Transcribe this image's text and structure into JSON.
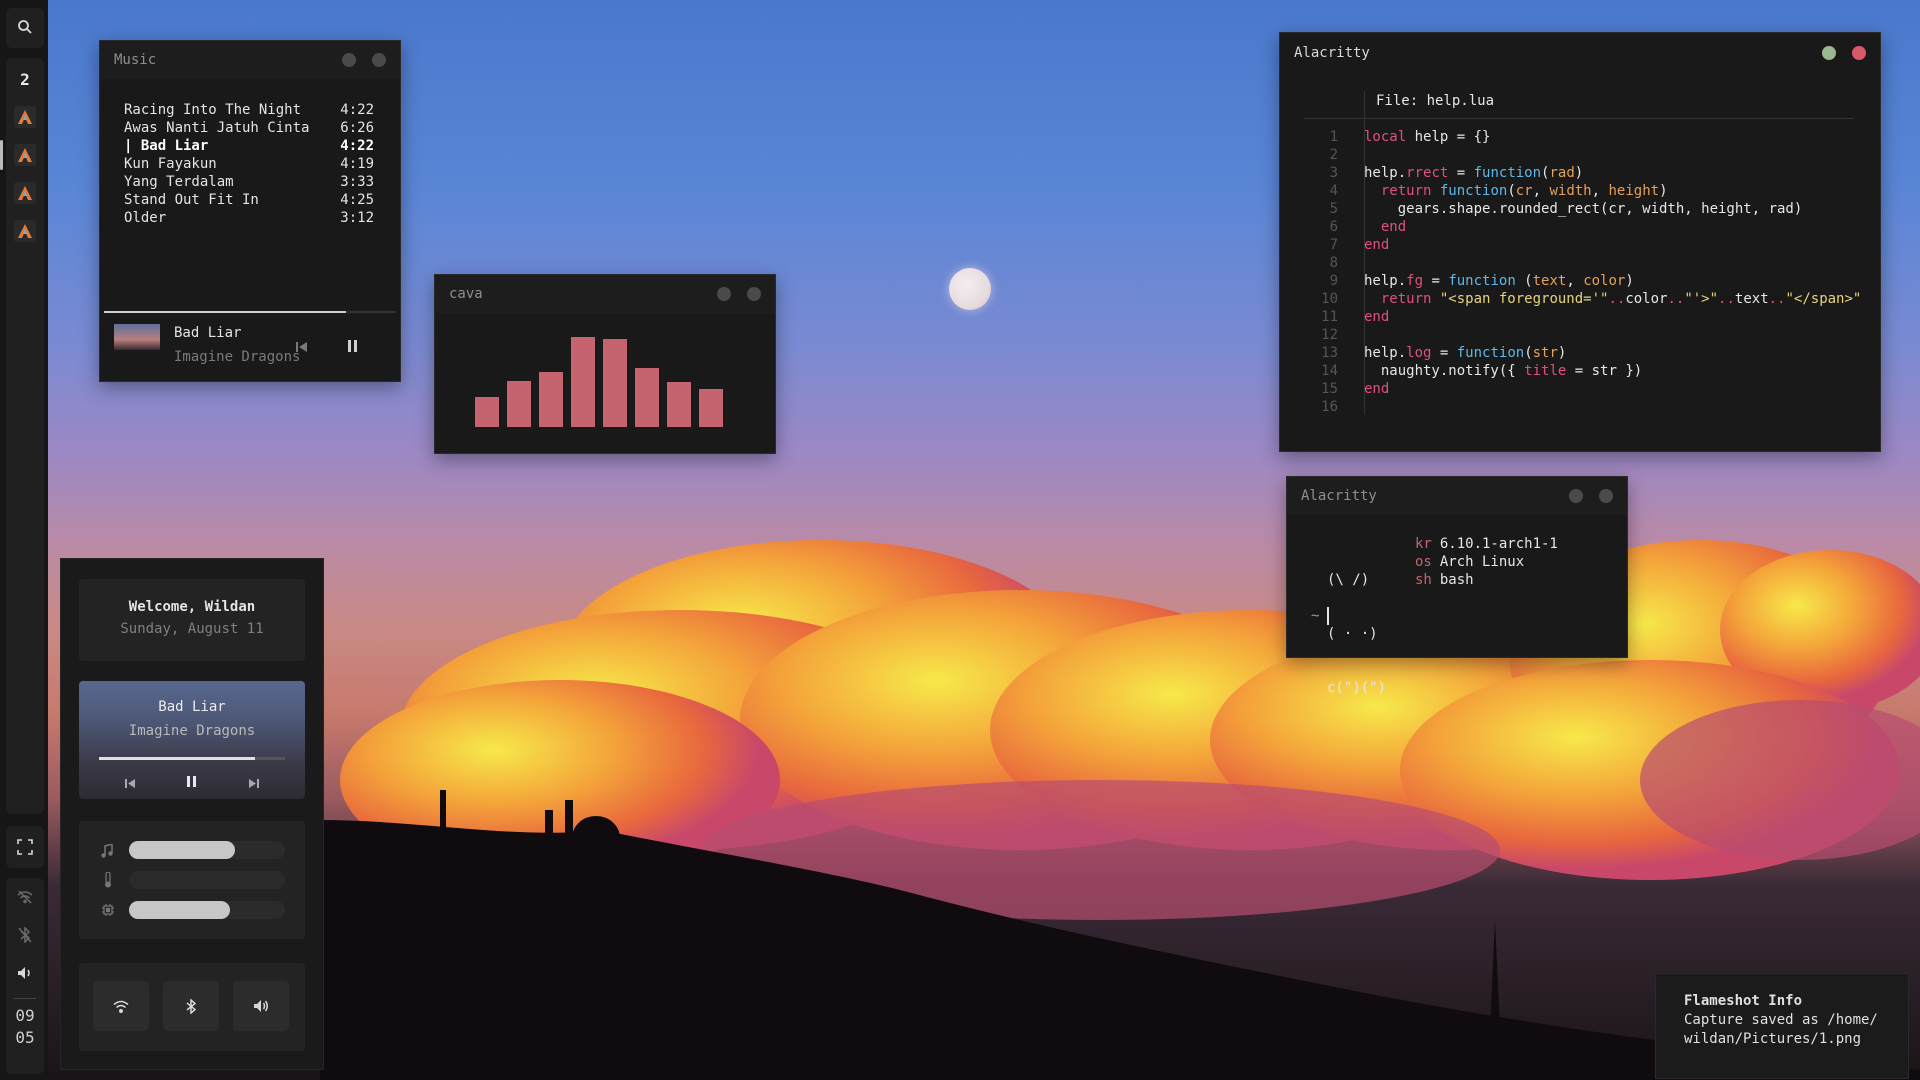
{
  "colors": {
    "bar_bg": "#161616",
    "window_bg": "#191919",
    "cava_bar": "#c5646e",
    "close_red": "#d9596a",
    "max_green": "#9cb68f",
    "keyword": "#e0517a",
    "function": "#5fb8e8",
    "param": "#e6a05a",
    "string": "#e8d37a"
  },
  "sidebar": {
    "search_icon": "search-icon",
    "workspace_number": "2",
    "app_icons": [
      "alacritty-icon",
      "alacritty-icon",
      "alacritty-icon",
      "alacritty-icon"
    ],
    "fullscreen_icon": "fullscreen-icon",
    "status_icons": [
      "wifi-off-icon",
      "bluetooth-off-icon",
      "volume-icon"
    ],
    "clock_hour": "09",
    "clock_minute": "05"
  },
  "music": {
    "title": "Music",
    "playlist": [
      {
        "name": "Racing Into The Night",
        "duration": "4:22"
      },
      {
        "name": "Awas Nanti Jatuh Cinta",
        "duration": "6:26"
      },
      {
        "name": "| Bad Liar",
        "duration": "4:22"
      },
      {
        "name": "Kun Fayakun",
        "duration": "4:19"
      },
      {
        "name": "Yang Terdalam",
        "duration": "3:33"
      },
      {
        "name": "Stand Out Fit In",
        "duration": "4:25"
      },
      {
        "name": "Older",
        "duration": "3:12"
      }
    ],
    "active_index": 2,
    "progress": 0.83,
    "now_playing_title": "Bad Liar",
    "now_playing_artist": "Imagine Dragons"
  },
  "cava": {
    "title": "cava",
    "bars": [
      0.3,
      0.46,
      0.55,
      0.9,
      0.88,
      0.59,
      0.45,
      0.38
    ]
  },
  "editor": {
    "title": "Alacritty",
    "file_label": "File: ",
    "file_name": "help.lua",
    "lines": [
      [
        [
          "k",
          "local"
        ],
        [
          "t",
          " help = {}"
        ]
      ],
      [],
      [
        [
          "t",
          "help."
        ],
        [
          "k",
          "rrect"
        ],
        [
          "t",
          " = "
        ],
        [
          "f",
          "function"
        ],
        [
          "t",
          "("
        ],
        [
          "p",
          "rad"
        ],
        [
          "t",
          ")"
        ]
      ],
      [
        [
          "t",
          "  "
        ],
        [
          "k",
          "return"
        ],
        [
          "t",
          " "
        ],
        [
          "f",
          "function"
        ],
        [
          "t",
          "("
        ],
        [
          "p",
          "cr"
        ],
        [
          "t",
          ", "
        ],
        [
          "p",
          "width"
        ],
        [
          "t",
          ", "
        ],
        [
          "p",
          "height"
        ],
        [
          "t",
          ")"
        ]
      ],
      [
        [
          "t",
          "    gears.shape.rounded_rect(cr, width, height, rad)"
        ]
      ],
      [
        [
          "t",
          "  "
        ],
        [
          "k",
          "end"
        ]
      ],
      [
        [
          "k",
          "end"
        ]
      ],
      [],
      [
        [
          "t",
          "help."
        ],
        [
          "k",
          "fg"
        ],
        [
          "t",
          " = "
        ],
        [
          "f",
          "function"
        ],
        [
          "t",
          " ("
        ],
        [
          "p",
          "text"
        ],
        [
          "t",
          ", "
        ],
        [
          "p",
          "color"
        ],
        [
          "t",
          ")"
        ]
      ],
      [
        [
          "t",
          "  "
        ],
        [
          "k",
          "return"
        ],
        [
          "t",
          " "
        ],
        [
          "s",
          "\"<span foreground='\""
        ],
        [
          "k",
          ".."
        ],
        [
          "t",
          "color"
        ],
        [
          "k",
          ".."
        ],
        [
          "s",
          "\"'>\""
        ],
        [
          "k",
          ".."
        ],
        [
          "t",
          "text"
        ],
        [
          "k",
          ".."
        ],
        [
          "s",
          "\"</span>\""
        ]
      ],
      [
        [
          "k",
          "end"
        ]
      ],
      [],
      [
        [
          "t",
          "help."
        ],
        [
          "k",
          "log"
        ],
        [
          "t",
          " = "
        ],
        [
          "f",
          "function"
        ],
        [
          "t",
          "("
        ],
        [
          "p",
          "str"
        ],
        [
          "t",
          ")"
        ]
      ],
      [
        [
          "t",
          "  naughty.notify({ "
        ],
        [
          "k",
          "title"
        ],
        [
          "t",
          " = str })"
        ]
      ],
      [
        [
          "k",
          "end"
        ]
      ],
      []
    ]
  },
  "fetch": {
    "title": "Alacritty",
    "art": [
      "(\\ /)",
      "( · ·)",
      "c(\")(\")"
    ],
    "info": [
      {
        "key": "kr",
        "value": "6.10.1-arch1-1"
      },
      {
        "key": "os",
        "value": "Arch Linux"
      },
      {
        "key": "sh",
        "value": "bash"
      }
    ],
    "prompt": "~"
  },
  "control_center": {
    "welcome": "Welcome, Wildan",
    "date": "Sunday, August 11",
    "track_title": "Bad Liar",
    "track_artist": "Imagine Dragons",
    "track_progress": 0.84,
    "sliders": [
      {
        "icon": "music-note-icon",
        "level": 0.68
      },
      {
        "icon": "thermometer-icon",
        "level": 0.0
      },
      {
        "icon": "cpu-icon",
        "level": 0.65
      }
    ],
    "toggles": [
      "wifi-icon",
      "bluetooth-icon",
      "volume-icon"
    ]
  },
  "notification": {
    "title": "Flameshot Info",
    "body": "Capture saved as /home/\nwildan/Pictures/1.png"
  }
}
